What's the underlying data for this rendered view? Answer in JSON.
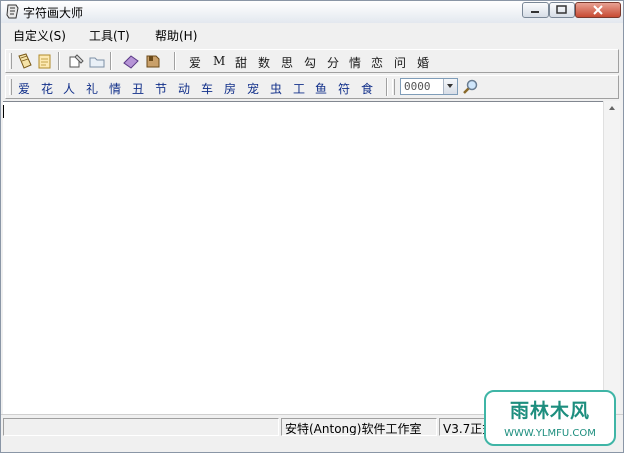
{
  "window": {
    "title": "字符画大师"
  },
  "menu": [
    "自定义(S)",
    "工具(T)",
    "帮助(H)"
  ],
  "toolbar1": {
    "icons": [
      "open-icon",
      "save-icon",
      "paint-icon",
      "folder-icon",
      "eraser-icon",
      "bookmark-icon"
    ],
    "chars": [
      "爱",
      "M",
      "甜",
      "数",
      "思",
      "勾",
      "分",
      "情",
      "恋",
      "问",
      "婚"
    ]
  },
  "toolbar2": {
    "chars": [
      "爱",
      "花",
      "人",
      "礼",
      "情",
      "丑",
      "节",
      "动",
      "车",
      "房",
      "宠",
      "虫",
      "工",
      "鱼",
      "符",
      "食"
    ],
    "combo_value": "0000",
    "search_icon": "magnifier-icon"
  },
  "editor": {
    "text": ""
  },
  "statusbar": {
    "panel1": "",
    "studio": "安特(Antong)软件工作室",
    "version": "V3.7正式"
  },
  "watermark": {
    "title": "雨林木风",
    "url": "WWW.YLMFU.COM"
  },
  "colors": {
    "char_link": "#12308a",
    "close_button": "#c74b33",
    "watermark": "#1d8e7e"
  }
}
